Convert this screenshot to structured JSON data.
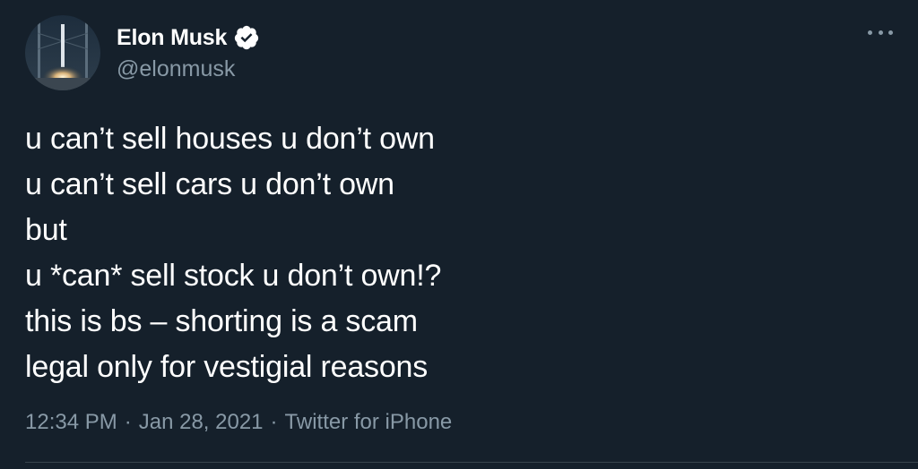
{
  "author": {
    "display_name": "Elon Musk",
    "handle": "@elonmusk",
    "verified": true,
    "avatar_icon": "rocket-launch-avatar",
    "verified_icon": "verified-badge-icon"
  },
  "tweet": {
    "lines": [
      "u can’t sell houses u don’t own",
      "u can’t sell cars u don’t own",
      "but",
      "u *can* sell stock u don’t own!?",
      "this is bs – shorting is a scam",
      "legal only for vestigial reasons"
    ]
  },
  "meta": {
    "time": "12:34 PM",
    "separator": "·",
    "date": "Jan 28, 2021",
    "source": "Twitter for iPhone"
  },
  "menu": {
    "icon": "more-options-icon"
  },
  "colors": {
    "background": "#15202b",
    "text": "#ffffff",
    "muted": "#8899a6",
    "divider": "#38444d"
  }
}
